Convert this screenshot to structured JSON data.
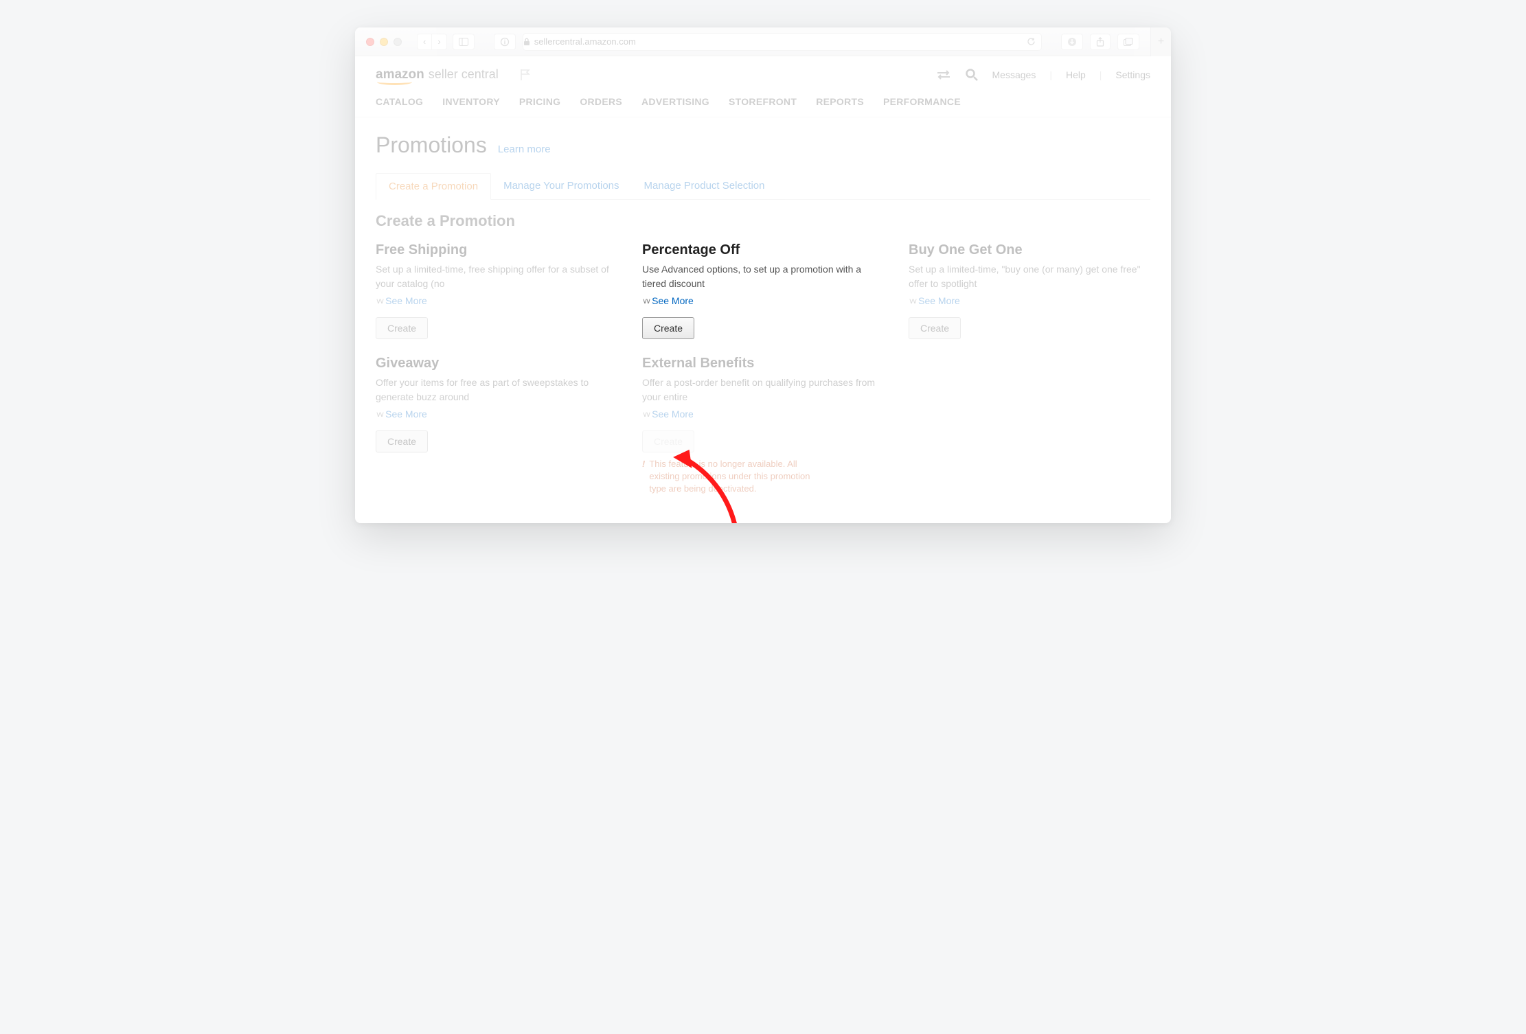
{
  "browser": {
    "url_host": "sellercentral.amazon.com"
  },
  "logo": {
    "brand": "amazon",
    "sub": "seller central"
  },
  "header_links": {
    "messages": "Messages",
    "help": "Help",
    "settings": "Settings"
  },
  "mainnav": {
    "catalog": "CATALOG",
    "inventory": "INVENTORY",
    "pricing": "PRICING",
    "orders": "ORDERS",
    "advertising": "ADVERTISING",
    "storefront": "STOREFRONT",
    "reports": "REPORTS",
    "performance": "PERFORMANCE"
  },
  "page_title": "Promotions",
  "learn_more": "Learn more",
  "tabs": {
    "create": "Create a Promotion",
    "manage": "Manage Your Promotions",
    "product": "Manage Product Selection"
  },
  "section_title": "Create a Promotion",
  "see_more_label": "See More",
  "create_label": "Create",
  "cards": {
    "free_shipping": {
      "title": "Free Shipping",
      "desc": "Set up a limited-time, free shipping offer for a subset of your catalog (no"
    },
    "percentage_off": {
      "title": "Percentage Off",
      "desc": "Use Advanced options, to set up a promotion with a tiered discount"
    },
    "bogo": {
      "title": "Buy One Get One",
      "desc": "Set up a limited-time, \"buy one (or many) get one free\" offer to spotlight"
    },
    "giveaway": {
      "title": "Giveaway",
      "desc": "Offer your items for free as part of sweepstakes to generate buzz around"
    },
    "external": {
      "title": "External Benefits",
      "desc": "Offer a post-order benefit on qualifying purchases from your entire",
      "warning": "This feature is no longer available. All existing promotions under this promotion type are being deactivated."
    }
  }
}
